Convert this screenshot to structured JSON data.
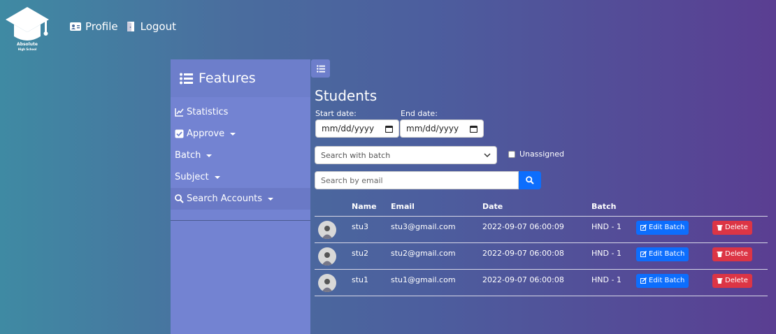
{
  "logo": {
    "line1": "Absolute",
    "line2": "High School"
  },
  "topnav": {
    "profile": "Profile",
    "logout": "Logout"
  },
  "sidebar": {
    "title": "Features",
    "items": [
      {
        "label": "Statistics",
        "icon": "chart-line-icon",
        "dropdown": false
      },
      {
        "label": "Approve",
        "icon": "check-square-icon",
        "dropdown": true
      },
      {
        "label": "Batch",
        "icon": null,
        "dropdown": true
      },
      {
        "label": "Subject",
        "icon": null,
        "dropdown": true
      },
      {
        "label": "Search Accounts",
        "icon": "search-icon",
        "dropdown": true,
        "active": true
      }
    ]
  },
  "main": {
    "title": "Students",
    "start_date_label": "Start date:",
    "end_date_label": "End date:",
    "start_date_placeholder": "mm/dd/yyyy",
    "end_date_placeholder": "mm/dd/yyyy",
    "batch_select": "Search with batch",
    "unassigned_label": "Unassigned",
    "email_placeholder": "Search by email"
  },
  "table": {
    "headers": [
      "",
      "Name",
      "Email",
      "Date",
      "Batch",
      "",
      ""
    ],
    "rows": [
      {
        "name": "stu3",
        "email": "stu3@gmail.com",
        "date": "2022-09-07 06:00:09",
        "batch": "HND - 1",
        "edit": "Edit Batch",
        "delete": "Delete"
      },
      {
        "name": "stu2",
        "email": "stu2@gmail.com",
        "date": "2022-09-07 06:00:08",
        "batch": "HND - 1",
        "edit": "Edit Batch",
        "delete": "Delete"
      },
      {
        "name": "stu1",
        "email": "stu1@gmail.com",
        "date": "2022-09-07 06:00:08",
        "batch": "HND - 1",
        "edit": "Edit Batch",
        "delete": "Delete"
      }
    ]
  },
  "colors": {
    "sidebar": "#7383d2",
    "primary": "#0d6efd",
    "danger": "#dc3545"
  }
}
